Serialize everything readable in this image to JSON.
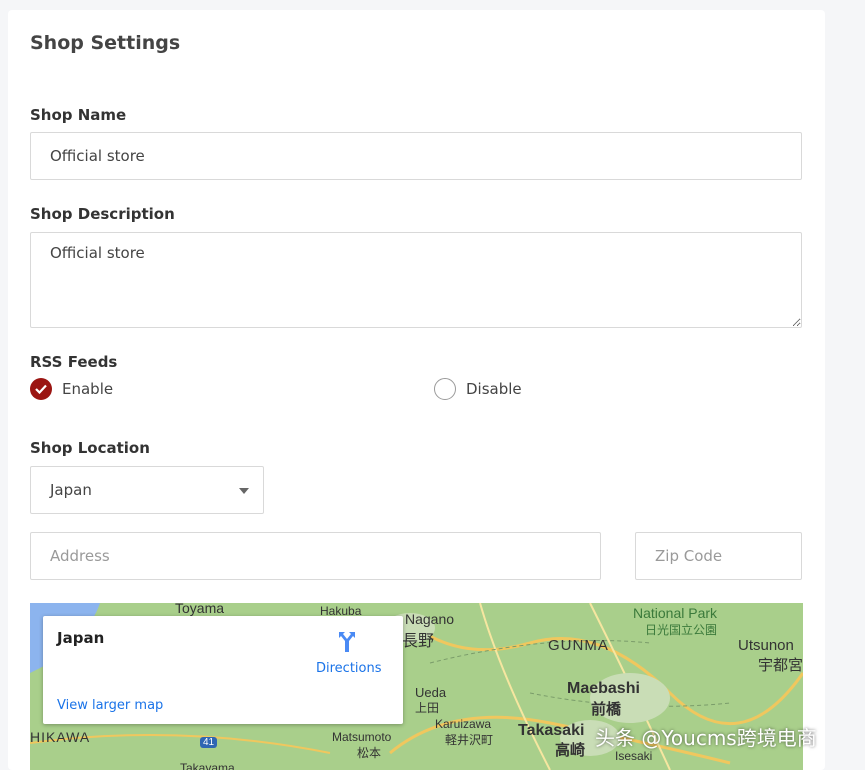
{
  "page": {
    "title": "Shop Settings"
  },
  "shop_name": {
    "label": "Shop Name",
    "value": "Official store"
  },
  "shop_description": {
    "label": "Shop Description",
    "value": "Official store"
  },
  "rss": {
    "label": "RSS Feeds",
    "options": [
      {
        "label": "Enable",
        "selected": true
      },
      {
        "label": "Disable",
        "selected": false
      }
    ],
    "accent_color": "#9b1512"
  },
  "location": {
    "label": "Shop Location",
    "country": "Japan",
    "address_placeholder": "Address",
    "zip_placeholder": "Zip Code"
  },
  "map": {
    "place": "Japan",
    "directions": "Directions",
    "view_larger": "View larger map",
    "labels": {
      "toyama": "Toyama",
      "hakuba": "Hakuba",
      "nagano": "Nagano",
      "nagano_jp": "長野",
      "national_park": "National Park",
      "national_park_jp": "日光国立公園",
      "gunma": "GUNMA",
      "utsunomiya": "Utsunon",
      "utsunomiya_jp": "宇都宮",
      "maebashi": "Maebashi",
      "maebashi_jp": "前橋",
      "ueda": "Ueda",
      "ueda_jp": "上田",
      "karuizawa": "Karuizawa",
      "karuizawa_jp": "軽井沢町",
      "takasaki": "Takasaki",
      "takasaki_jp": "高崎",
      "matsumoto": "Matsumoto",
      "matsumoto_jp": "松本",
      "ishikawa": "HIKAWA",
      "takayama": "Takayama",
      "isesaki": "Isesaki",
      "route41": "41"
    },
    "colors": {
      "link": "#1a73e8",
      "land": "#a9cf8b"
    }
  },
  "watermark": "头条 @Youcms跨境电商"
}
